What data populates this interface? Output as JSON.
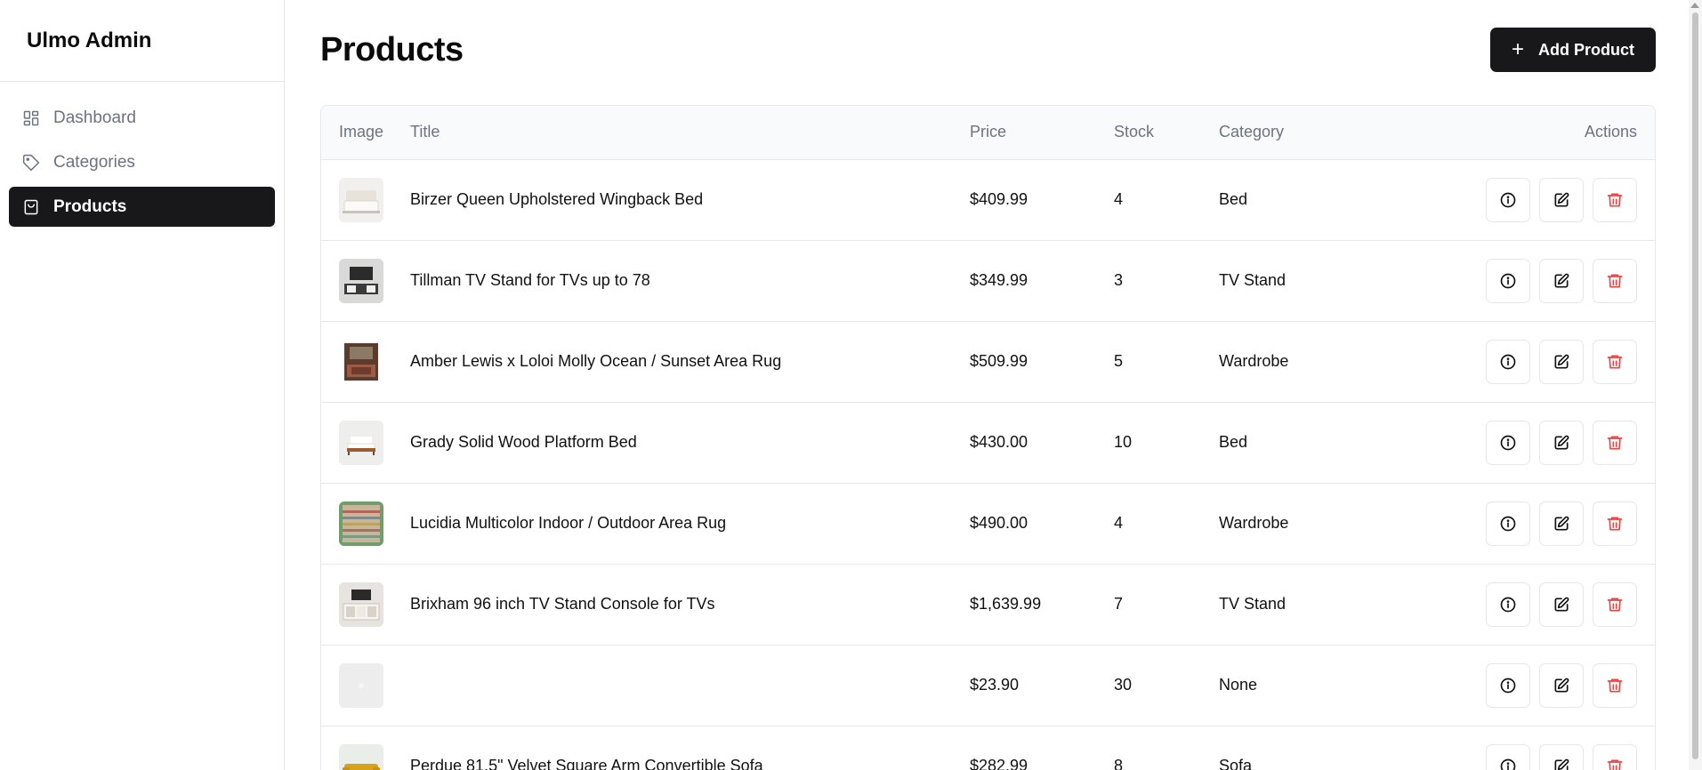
{
  "brand": {
    "title": "Ulmo Admin"
  },
  "sidebar": {
    "items": [
      {
        "label": "Dashboard",
        "icon": "dashboard-icon",
        "active": false
      },
      {
        "label": "Categories",
        "icon": "tag-icon",
        "active": false
      },
      {
        "label": "Products",
        "icon": "shopping-bag-icon",
        "active": true
      }
    ]
  },
  "header": {
    "title": "Products",
    "add_button_label": "Add Product",
    "add_button_icon": "plus-icon"
  },
  "table": {
    "columns": [
      "Image",
      "Title",
      "Price",
      "Stock",
      "Category",
      "Actions"
    ],
    "rows": [
      {
        "title": "Birzer Queen Upholstered Wingback Bed",
        "price": "$409.99",
        "stock": "4",
        "category": "Bed",
        "image": "bed-thumbnail"
      },
      {
        "title": "Tillman TV Stand for TVs up to 78",
        "price": "$349.99",
        "stock": "3",
        "category": "TV Stand",
        "image": "tv-stand-thumbnail"
      },
      {
        "title": "Amber Lewis x Loloi Molly Ocean / Sunset Area Rug",
        "price": "$509.99",
        "stock": "5",
        "category": "Wardrobe",
        "image": "room-rug-thumbnail"
      },
      {
        "title": "Grady Solid Wood Platform Bed",
        "price": "$430.00",
        "stock": "10",
        "category": "Bed",
        "image": "wood-bed-thumbnail"
      },
      {
        "title": "Lucidia Multicolor Indoor / Outdoor Area Rug",
        "price": "$490.00",
        "stock": "4",
        "category": "Wardrobe",
        "image": "striped-rug-thumbnail"
      },
      {
        "title": "Brixham 96 inch TV Stand Console for TVs",
        "price": "$1,639.99",
        "stock": "7",
        "category": "TV Stand",
        "image": "tv-console-thumbnail"
      },
      {
        "title": "",
        "price": "$23.90",
        "stock": "30",
        "category": "None",
        "image": "placeholder-thumbnail"
      },
      {
        "title": "Perdue 81.5\" Velvet Square Arm Convertible Sofa",
        "price": "$282.99",
        "stock": "8",
        "category": "Sofa",
        "image": "sofa-thumbnail"
      }
    ],
    "row_actions": [
      "info-icon",
      "edit-icon",
      "trash-icon"
    ]
  },
  "colors": {
    "primary": "#18181b",
    "muted_text": "#6b7280",
    "border": "#e5e7eb",
    "danger": "#ef4444"
  }
}
